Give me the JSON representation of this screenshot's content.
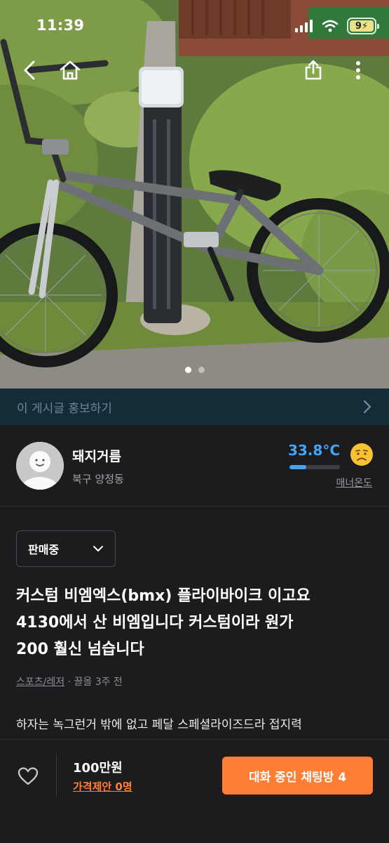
{
  "status_bar": {
    "time": "11:39",
    "battery_level": "94",
    "battery_shown": "9⚡"
  },
  "hero": {
    "icons": [
      "chevron-left-icon",
      "home-icon",
      "share-icon",
      "more-vertical-icon"
    ],
    "slide_index": 1,
    "slide_count": 2
  },
  "promo": {
    "label": "이 게시글 홍보하기",
    "icon": "chevron-right-icon"
  },
  "seller": {
    "name": "돼지거름",
    "location": "북구 양정동",
    "temperature": "33.8°C",
    "temperature_level": 0.34,
    "manner_label": "매너온도",
    "face_icon": "worried-face-icon"
  },
  "status_select": {
    "value": "판매중",
    "icon": "chevron-down-icon"
  },
  "post": {
    "title_lines": [
      "커스텀 비엠엑스(bmx) 플라이바이크 이고요",
      "4130에서 산 비엠입니다 커스텀이라 원가",
      "200 훨신 넘습니다"
    ],
    "category": "스포츠/레저",
    "meta_separator": " · ",
    "time_ago": "끌올 3주 전",
    "body_preview": "하자는 녹그런거 밖에 없고 페달 스페셜라이즈드라 접지력"
  },
  "bottom_bar": {
    "like_icon": "heart-outline-icon",
    "price": "100만원",
    "price_offer": "가격제안 0명",
    "chat_button": "대화 중인 채팅방 4"
  },
  "colors": {
    "background": "#1c1c1e",
    "accent": "#ff7e36",
    "temperature": "#46a4f0",
    "promo_bg": "#142b38"
  }
}
